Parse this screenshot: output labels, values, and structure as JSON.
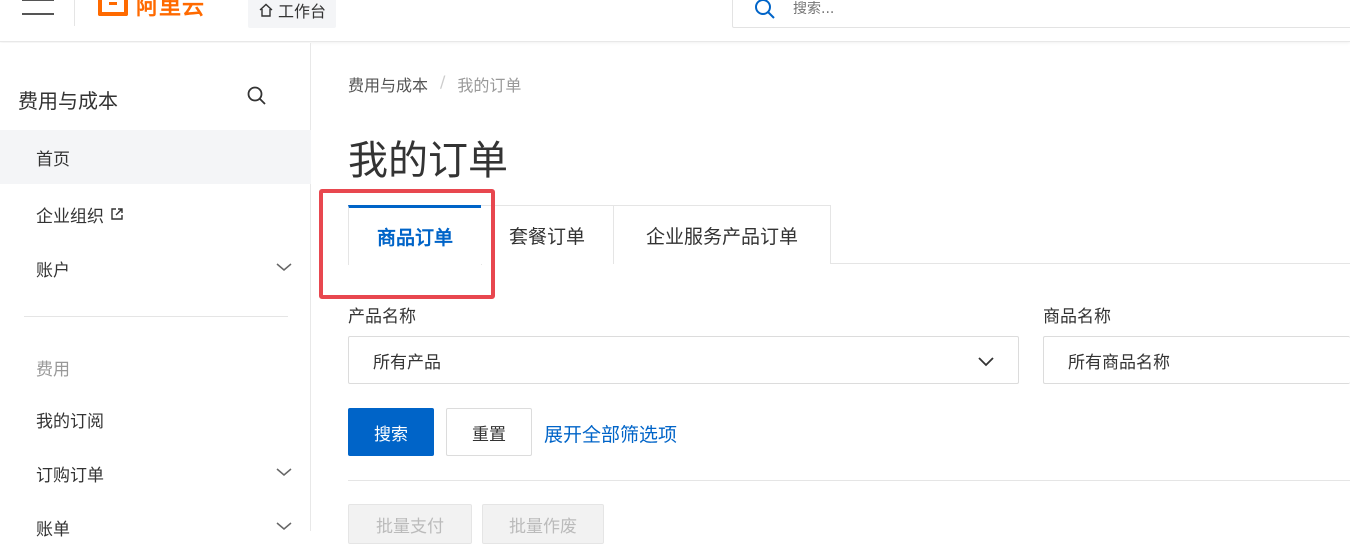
{
  "brand": {
    "logo_text": "阿里云",
    "accent": "#ff6a00",
    "primary": "#0064c8",
    "highlight": "#e8474f"
  },
  "topbar": {
    "workbench_label": "工作台",
    "search_placeholder": "搜索..."
  },
  "sidebar": {
    "title": "费用与成本",
    "items": [
      {
        "label": "首页",
        "active": true
      },
      {
        "label": "企业组织",
        "icon": "external-link-icon"
      },
      {
        "label": "账户",
        "icon": "chevron-down-icon"
      }
    ],
    "group_label": "费用",
    "group_items": [
      {
        "label": "我的订阅"
      },
      {
        "label": "订购订单",
        "icon": "chevron-down-icon"
      },
      {
        "label": "账单",
        "icon": "chevron-down-icon"
      }
    ]
  },
  "breadcrumb": {
    "parent": "费用与成本",
    "separator": "/",
    "current": "我的订单"
  },
  "page_title": "我的订单",
  "tabs": [
    {
      "label": "商品订单",
      "active": true
    },
    {
      "label": "套餐订单"
    },
    {
      "label": "企业服务产品订单"
    }
  ],
  "filters": {
    "product": {
      "label": "产品名称",
      "value": "所有产品"
    },
    "goods": {
      "label": "商品名称",
      "value": "所有商品名称"
    }
  },
  "actions": {
    "search_label": "搜索",
    "reset_label": "重置",
    "expand_label": "展开全部筛选项",
    "batch_pay_label": "批量支付",
    "batch_cancel_label": "批量作废"
  }
}
